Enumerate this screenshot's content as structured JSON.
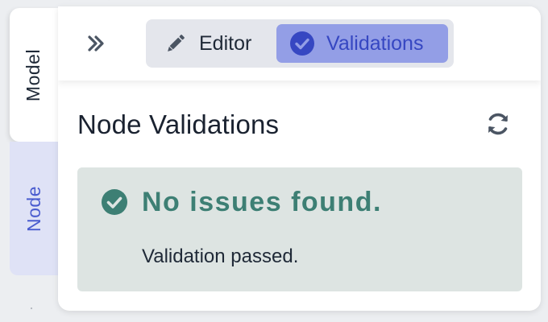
{
  "side_tabs": [
    {
      "label": "Model",
      "active": false
    },
    {
      "label": "Node",
      "active": true
    }
  ],
  "header": {
    "expand_icon": "double-chevron-right-icon",
    "segments": [
      {
        "label": "Editor",
        "icon": "pencil-icon",
        "active": false
      },
      {
        "label": "Validations",
        "icon": "check-circle-icon",
        "active": true
      }
    ]
  },
  "main": {
    "title": "Node Validations",
    "refresh_icon": "refresh-icon",
    "result": {
      "icon": "check-circle-icon",
      "heading": "No issues found.",
      "detail": "Validation passed."
    }
  },
  "colors": {
    "accent": "#939ee6",
    "accent_text": "#3647c2",
    "success": "#3d7f74",
    "success_bg": "#dde4e2",
    "inactive_tab_bg": "#dfe2f6"
  }
}
